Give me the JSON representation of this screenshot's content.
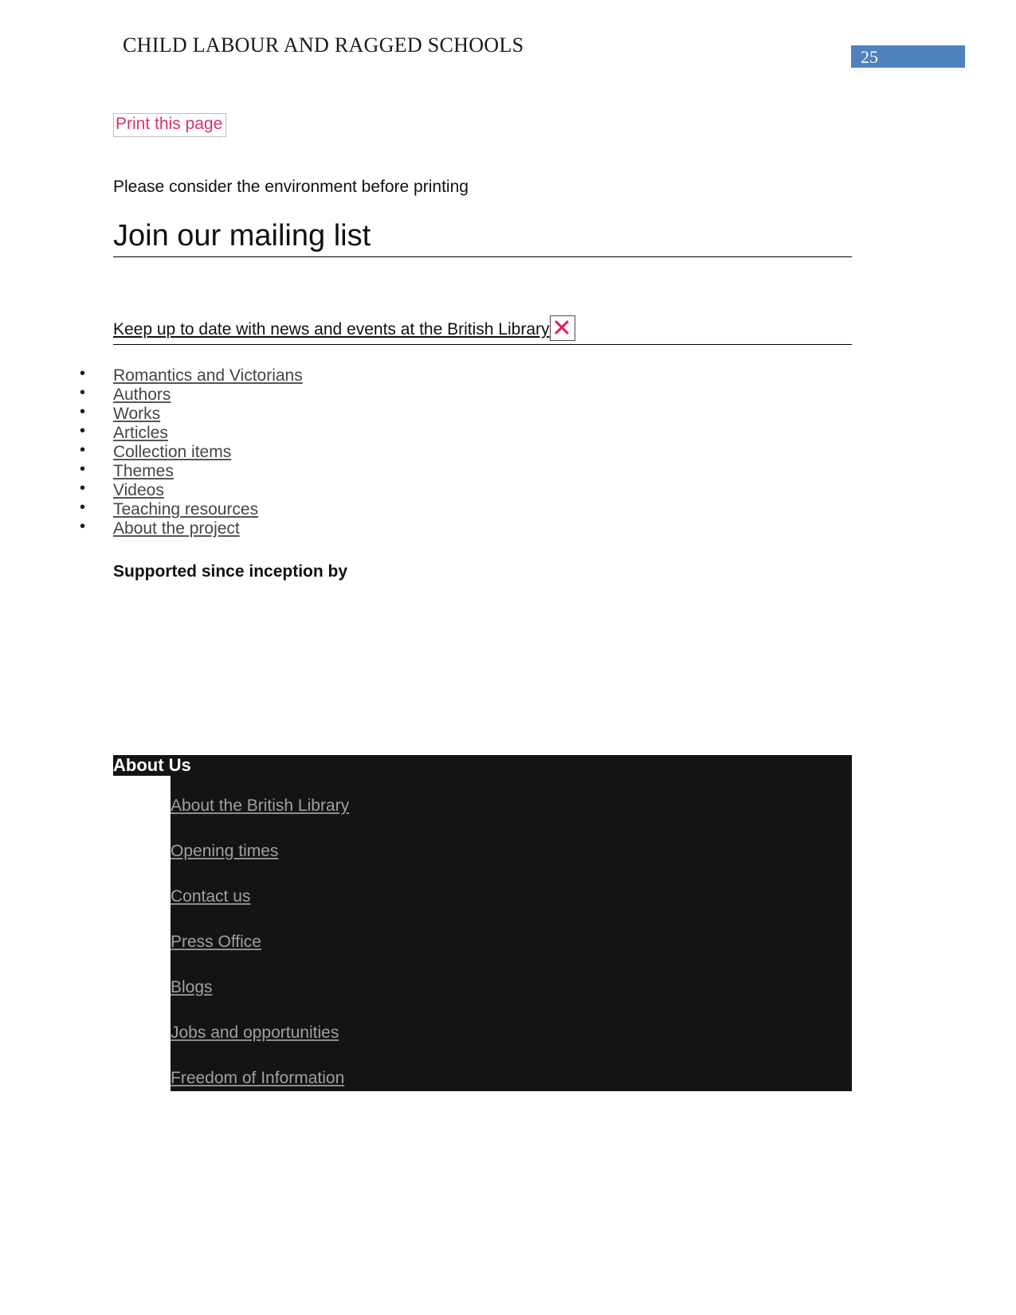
{
  "header": {
    "title": "CHILD LABOUR AND RAGGED SCHOOLS",
    "page_number": "25",
    "badge_color": "#4f81bd"
  },
  "actions": {
    "print_label": "Print this page",
    "print_color": "#d6336c",
    "environment_note": "Please consider the environment before printing"
  },
  "mailing": {
    "heading": "Join our mailing list",
    "subscribe_text": "Keep up to date with news and events at the British Library",
    "broken_image_icon": "broken-image-x-icon"
  },
  "nav": {
    "items": [
      {
        "label": "Romantics and Victorians"
      },
      {
        "label": "Authors"
      },
      {
        "label": "Works"
      },
      {
        "label": "Articles"
      },
      {
        "label": "Collection items"
      },
      {
        "label": "Themes"
      },
      {
        "label": "Videos"
      },
      {
        "label": "Teaching resources"
      },
      {
        "label": "About the project"
      }
    ]
  },
  "supporters": {
    "heading": "Supported since inception by"
  },
  "footer": {
    "heading": "About Us",
    "background_color": "#141414",
    "link_color": "#a0a0a0",
    "links": [
      {
        "label": "About the British Library"
      },
      {
        "label": "Opening times"
      },
      {
        "label": "Contact us"
      },
      {
        "label": "Press Office"
      },
      {
        "label": "Blogs"
      },
      {
        "label": "Jobs and opportunities"
      },
      {
        "label": "Freedom of Information"
      }
    ]
  }
}
